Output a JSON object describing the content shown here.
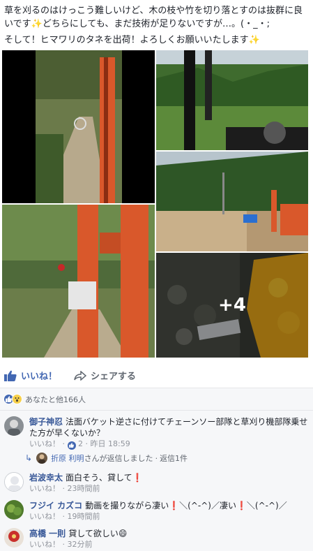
{
  "post": {
    "line1": "草を刈るのはけっこう難しいけど、木の枝や竹を切り落とすのは抜群に良いです",
    "line1_end": "どちらにしても、まだ技術が足りないですが…。(・_・;",
    "line2": "そして！ヒマワリのタネを出荷！よろしくお願いいたします",
    "sparkle": "✨"
  },
  "photos": {
    "more_label": "+4"
  },
  "actions": {
    "like_label": "いいね！",
    "share_label": "シェアする"
  },
  "reactions": {
    "summary": "あなたと他166人"
  },
  "comments": [
    {
      "name": "御子神忍",
      "text": "法面バケット逆さに付けてチェーンソー部隊と草刈り機部隊乗せた方が早くないか？",
      "like": "いいね！",
      "dot": "·",
      "likes_count": "2",
      "time": "昨日 18:59"
    },
    {
      "name": "岩波幸太",
      "text": "面白そう、貸して",
      "mark": "❗",
      "like": "いいね！",
      "dot": "·",
      "time": "23時間前"
    },
    {
      "name": "フジイ カズコ",
      "text": "動画を撮りながら凄い",
      "text2": "＼(^-^)／凄い",
      "text3": "＼(^-^)／",
      "mark": "❗",
      "like": "いいね！",
      "dot": "·",
      "time": "19時間前"
    },
    {
      "name": "高橋 一則",
      "text": "貸して欲しい",
      "emoji": "😄",
      "like": "いいね！",
      "dot": "·",
      "time": "32分前"
    }
  ],
  "reply": {
    "author": "折原 利明",
    "text": "さんが返信しました",
    "dot": "·",
    "count": "返信1件"
  },
  "colors": {
    "facebook_blue": "#4267b2",
    "name_blue": "#385898",
    "excavator_orange": "#d9582b"
  }
}
